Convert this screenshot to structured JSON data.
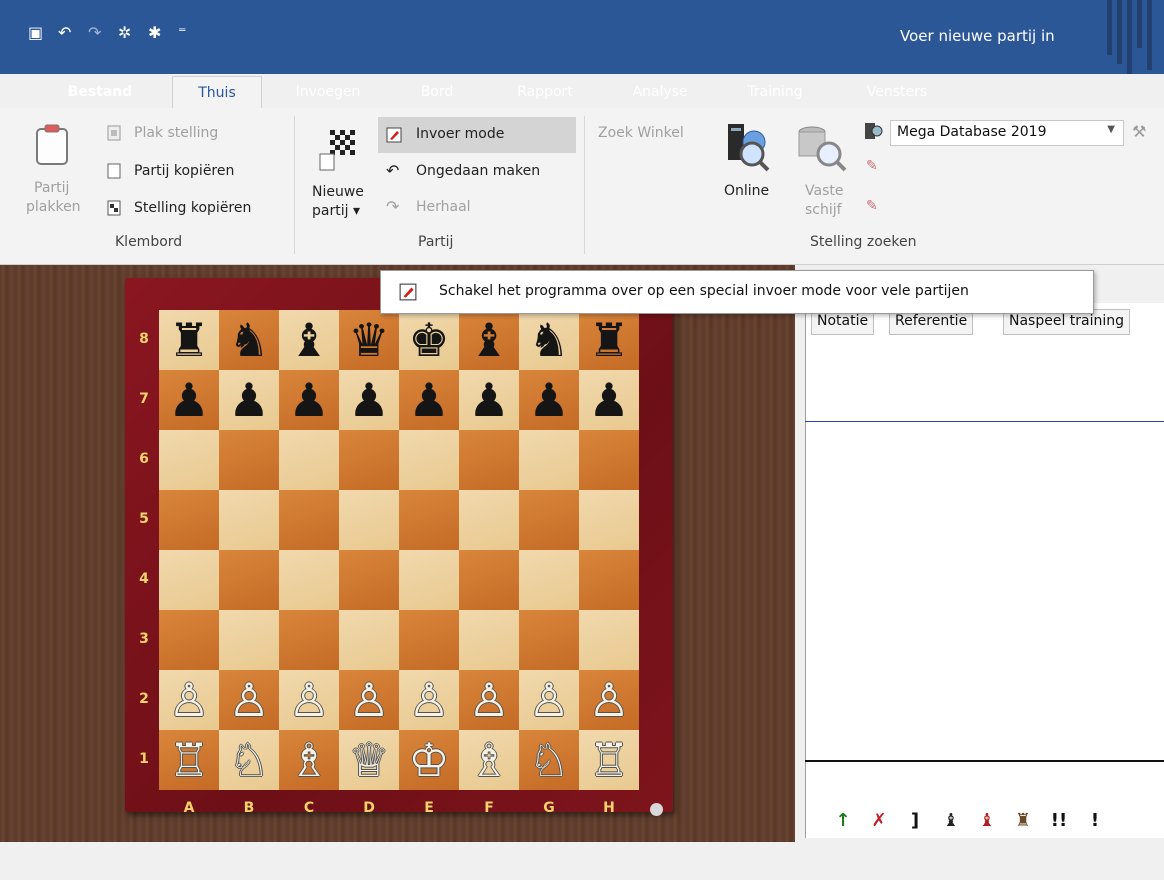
{
  "window": {
    "title": "Voer nieuwe partij in"
  },
  "quick_access": [
    {
      "icon": "save-icon",
      "glyph": "▣"
    },
    {
      "icon": "undo-icon",
      "glyph": "↶"
    },
    {
      "icon": "redo-icon",
      "glyph": "↷"
    },
    {
      "icon": "engine-icon",
      "glyph": "✲"
    },
    {
      "icon": "bug-icon",
      "glyph": "✱"
    },
    {
      "icon": "customize-icon",
      "glyph": "⁼"
    }
  ],
  "tabs": [
    "Bestand",
    "Thuis",
    "Invoegen",
    "Bord",
    "Rapport",
    "Analyse",
    "Training",
    "Vensters"
  ],
  "ribbon": {
    "klembord": {
      "label": "Klembord",
      "paste_game_line1": "Partij",
      "paste_game_line2": "plakken",
      "paste_position": "Plak stelling",
      "copy_game": "Partij kopiëren",
      "copy_position": "Stelling kopiëren"
    },
    "partij": {
      "label": "Partij",
      "new_game_line1": "Nieuwe",
      "new_game_line2": "partij ▾",
      "entry_mode": "Invoer mode",
      "undo": "Ongedaan maken",
      "redo": "Herhaal"
    },
    "stelling_zoeken": {
      "label": "Stelling zoeken",
      "shop_search": "Zoek Winkel",
      "online": "Online",
      "hard_disk_line1": "Vaste",
      "hard_disk_line2": "schijf",
      "database": "Mega Database 2019"
    }
  },
  "tooltip": {
    "text": "Schakel het programma over op een special invoer mode voor vele partijen"
  },
  "board": {
    "ranks": [
      "8",
      "7",
      "6",
      "5",
      "4",
      "3",
      "2",
      "1"
    ],
    "files": [
      "A",
      "B",
      "C",
      "D",
      "E",
      "F",
      "G",
      "H"
    ],
    "position": [
      [
        "b:♜",
        "b:♞",
        "b:♝",
        "b:♛",
        "b:♚",
        "b:♝",
        "b:♞",
        "b:♜"
      ],
      [
        "b:♟",
        "b:♟",
        "b:♟",
        "b:♟",
        "b:♟",
        "b:♟",
        "b:♟",
        "b:♟"
      ],
      [
        "",
        "",
        "",
        "",
        "",
        "",
        "",
        ""
      ],
      [
        "",
        "",
        "",
        "",
        "",
        "",
        "",
        ""
      ],
      [
        "",
        "",
        "",
        "",
        "",
        "",
        "",
        ""
      ],
      [
        "",
        "",
        "",
        "",
        "",
        "",
        "",
        ""
      ],
      [
        "w:♙",
        "w:♙",
        "w:♙",
        "w:♙",
        "w:♙",
        "w:♙",
        "w:♙",
        "w:♙"
      ],
      [
        "w:♖",
        "w:♘",
        "w:♗",
        "w:♕",
        "w:♔",
        "w:♗",
        "w:♘",
        "w:♖"
      ]
    ]
  },
  "right_panel": {
    "tabs": [
      "Notatie",
      "Referentie",
      "Naspeel training"
    ],
    "toolbar": [
      {
        "icon": "arrow-up-icon",
        "glyph": "↑",
        "color": "#1d7a1d"
      },
      {
        "icon": "delete-move-icon",
        "glyph": "✗",
        "color": "#c0202a"
      },
      {
        "icon": "bracket-icon",
        "glyph": "]",
        "color": "#111111"
      },
      {
        "icon": "piece-annotation-icon",
        "glyph": "♝",
        "color": "#222222"
      },
      {
        "icon": "piece-red-icon",
        "glyph": "♝",
        "color": "#b02020"
      },
      {
        "icon": "pieces-icon",
        "glyph": "♜",
        "color": "#6b4a2a"
      },
      {
        "icon": "double-exclamation-icon",
        "glyph": "!!",
        "color": "#111111"
      },
      {
        "icon": "exclamation-icon",
        "glyph": "!",
        "color": "#111111"
      }
    ]
  }
}
